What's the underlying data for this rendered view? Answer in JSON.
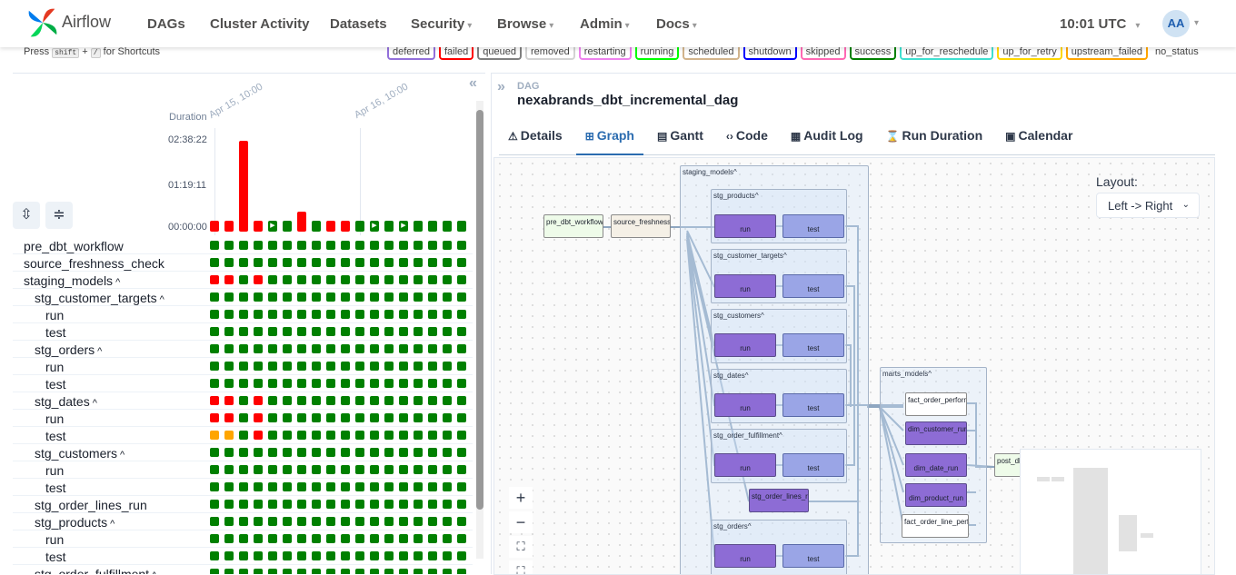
{
  "navbar": {
    "brand": "Airflow",
    "items": [
      {
        "label": "DAGs",
        "has_menu": false
      },
      {
        "label": "Cluster Activity",
        "has_menu": false
      },
      {
        "label": "Datasets",
        "has_menu": false
      },
      {
        "label": "Security",
        "has_menu": true
      },
      {
        "label": "Browse",
        "has_menu": true
      },
      {
        "label": "Admin",
        "has_menu": true
      },
      {
        "label": "Docs",
        "has_menu": true
      }
    ],
    "clock": "10:01 UTC",
    "user_initials": "AA"
  },
  "shortcut_hint": {
    "prefix": "Press",
    "key1": "shift",
    "plus": "+",
    "key2": "/",
    "suffix": "for Shortcuts"
  },
  "status_legend": [
    {
      "label": "deferred",
      "color": "#9370db"
    },
    {
      "label": "failed",
      "color": "#ff0000"
    },
    {
      "label": "queued",
      "color": "#808080"
    },
    {
      "label": "removed",
      "color": "#d3d3d3"
    },
    {
      "label": "restarting",
      "color": "#ee82ee"
    },
    {
      "label": "running",
      "color": "#00ff00"
    },
    {
      "label": "scheduled",
      "color": "#d2b48c"
    },
    {
      "label": "shutdown",
      "color": "#0000ff"
    },
    {
      "label": "skipped",
      "color": "#ff69b4"
    },
    {
      "label": "success",
      "color": "#008000"
    },
    {
      "label": "up_for_reschedule",
      "color": "#40e0d0"
    },
    {
      "label": "up_for_retry",
      "color": "#ffd700"
    },
    {
      "label": "upstream_failed",
      "color": "#ffa500"
    },
    {
      "label": "no_status",
      "color": ""
    }
  ],
  "colors": {
    "success": "#008000",
    "failed": "#ff0000",
    "upstream_failed": "#ffa500"
  },
  "grid": {
    "collapse_icon": "double-chevron-left-icon",
    "duration_label": "Duration",
    "y_ticks": [
      "02:38:22",
      "01:19:11",
      "00:00:00"
    ],
    "date_labels": [
      "Apr 15, 10:00",
      "Apr 16, 10:00"
    ],
    "run_bars": [
      {
        "state": "failed",
        "frac": 0.08,
        "play": false
      },
      {
        "state": "failed",
        "frac": 0.08,
        "play": false
      },
      {
        "state": "failed",
        "frac": 1.0,
        "play": false
      },
      {
        "state": "failed",
        "frac": 0.08,
        "play": false
      },
      {
        "state": "success",
        "frac": 0.08,
        "play": true
      },
      {
        "state": "success",
        "frac": 0.08,
        "play": false
      },
      {
        "state": "failed",
        "frac": 0.22,
        "play": false
      },
      {
        "state": "success",
        "frac": 0.08,
        "play": false
      },
      {
        "state": "failed",
        "frac": 0.08,
        "play": false
      },
      {
        "state": "failed",
        "frac": 0.08,
        "play": false
      },
      {
        "state": "success",
        "frac": 0.08,
        "play": false
      },
      {
        "state": "success",
        "frac": 0.08,
        "play": true
      },
      {
        "state": "success",
        "frac": 0.08,
        "play": false
      },
      {
        "state": "success",
        "frac": 0.08,
        "play": true
      },
      {
        "state": "success",
        "frac": 0.08,
        "play": false
      },
      {
        "state": "success",
        "frac": 0.08,
        "play": false
      },
      {
        "state": "success",
        "frac": 0.08,
        "play": false
      },
      {
        "state": "success",
        "frac": 0.08,
        "play": false
      }
    ],
    "rows": [
      {
        "label": "pre_dbt_workflow",
        "indent": 0,
        "expandable": false,
        "cells": "SSSSSSSSSSSSSSSSSS"
      },
      {
        "label": "source_freshness_check",
        "indent": 0,
        "expandable": false,
        "cells": "SSSSSSSSSSSSSSSSSS"
      },
      {
        "label": "staging_models",
        "indent": 0,
        "expandable": true,
        "cells": "FFSFSSSSSSSSSSSSSS"
      },
      {
        "label": "stg_customer_targets",
        "indent": 1,
        "expandable": true,
        "cells": "SSSSSSSSSSSSSSSSSS"
      },
      {
        "label": "run",
        "indent": 2,
        "expandable": false,
        "cells": "SSSSSSSSSSSSSSSSSS"
      },
      {
        "label": "test",
        "indent": 2,
        "expandable": false,
        "cells": "SSSSSSSSSSSSSSSSSS"
      },
      {
        "label": "stg_orders",
        "indent": 1,
        "expandable": true,
        "cells": "SSSSSSSSSSSSSSSSSS"
      },
      {
        "label": "run",
        "indent": 2,
        "expandable": false,
        "cells": "SSSSSSSSSSSSSSSSSS"
      },
      {
        "label": "test",
        "indent": 2,
        "expandable": false,
        "cells": "SSSSSSSSSSSSSSSSSS"
      },
      {
        "label": "stg_dates",
        "indent": 1,
        "expandable": true,
        "cells": "FFSFSSSSSSSSSSSSSS"
      },
      {
        "label": "run",
        "indent": 2,
        "expandable": false,
        "cells": "FFSFSSSSSSSSSSSSSS"
      },
      {
        "label": "test",
        "indent": 2,
        "expandable": false,
        "cells": "UUSFSSSSSSSSSSSSSS"
      },
      {
        "label": "stg_customers",
        "indent": 1,
        "expandable": true,
        "cells": "SSSSSSSSSSSSSSSSSS"
      },
      {
        "label": "run",
        "indent": 2,
        "expandable": false,
        "cells": "SSSSSSSSSSSSSSSSSS"
      },
      {
        "label": "test",
        "indent": 2,
        "expandable": false,
        "cells": "SSSSSSSSSSSSSSSSSS"
      },
      {
        "label": "stg_order_lines_run",
        "indent": 1,
        "expandable": false,
        "cells": "SSSSSSSSSSSSSSSSSS"
      },
      {
        "label": "stg_products",
        "indent": 1,
        "expandable": true,
        "cells": "SSSSSSSSSSSSSSSSSS"
      },
      {
        "label": "run",
        "indent": 2,
        "expandable": false,
        "cells": "SSSSSSSSSSSSSSSSSS"
      },
      {
        "label": "test",
        "indent": 2,
        "expandable": false,
        "cells": "SSSSSSSSSSSSSSSSSS"
      },
      {
        "label": "stg_order_fulfillment",
        "indent": 1,
        "expandable": true,
        "cells": "SSSSSSSSSSSSSSSSSS"
      }
    ]
  },
  "dag": {
    "kicker": "DAG",
    "name": "nexabrands_dbt_incremental_dag",
    "tabs": [
      {
        "label": "Details",
        "icon": "warning-icon",
        "glyph": "⚠",
        "active": false
      },
      {
        "label": "Graph",
        "icon": "graph-icon",
        "glyph": "⊞",
        "active": true
      },
      {
        "label": "Gantt",
        "icon": "gantt-icon",
        "glyph": "▤",
        "active": false
      },
      {
        "label": "Code",
        "icon": "code-icon",
        "glyph": "‹›",
        "active": false
      },
      {
        "label": "Audit Log",
        "icon": "document-icon",
        "glyph": "▦",
        "active": false
      },
      {
        "label": "Run Duration",
        "icon": "hourglass-icon",
        "glyph": "⌛",
        "active": false
      },
      {
        "label": "Calendar",
        "icon": "calendar-icon",
        "glyph": "▣",
        "active": false
      }
    ]
  },
  "graph": {
    "layout_label": "Layout:",
    "layout_value": "Left -> Right",
    "nodes": {
      "pre_dbt": "pre_dbt_workflow",
      "source_freshness": "source_freshness_check",
      "post": "post_dbt_workflow",
      "run": "run",
      "test": "test",
      "stg_order_lines": "stg_order_lines_run",
      "fact_order_perf": "fact_order_performance",
      "dim_customer": "dim_customer_run",
      "dim_date": "dim_date_run",
      "dim_product": "dim_product_run",
      "fact_order_line_perf": "fact_order_line_performance"
    },
    "groups": {
      "staging": "staging_models",
      "stg_products": "stg_products",
      "stg_customer_targets": "stg_customer_targets",
      "stg_customers": "stg_customers",
      "stg_dates": "stg_dates",
      "stg_order_fulfillment": "stg_order_fulfillment",
      "stg_orders": "stg_orders",
      "marts": "marts_models"
    },
    "zoom_in": "+",
    "zoom_out": "−",
    "fit": "⛶",
    "lock": "⛶"
  }
}
